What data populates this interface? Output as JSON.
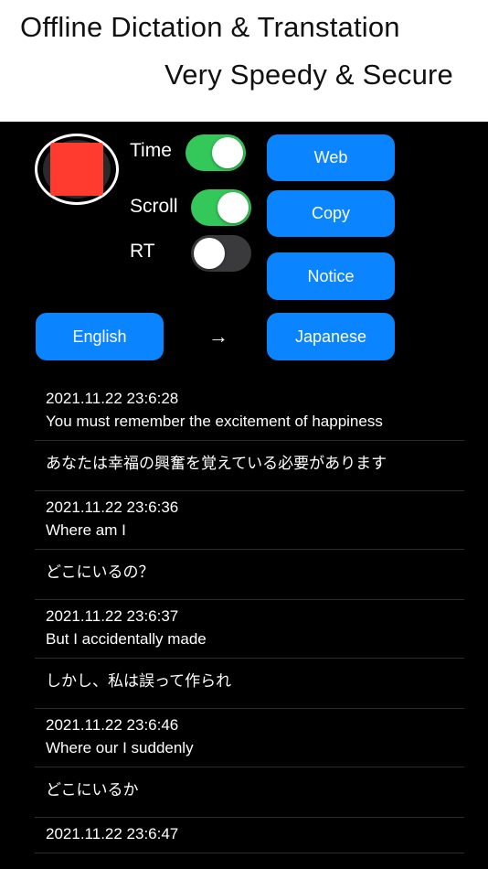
{
  "banner": {
    "line1": "Offline Dictation & Transtation",
    "line2": "Very Speedy & Secure"
  },
  "controls": {
    "record_icon": "stop-square-icon",
    "time_label": "Time",
    "time_on": true,
    "scroll_label": "Scroll",
    "scroll_on": true,
    "rt_label": "RT",
    "rt_on": false
  },
  "buttons": {
    "web": "Web",
    "copy": "Copy",
    "notice": "Notice",
    "source_lang": "English",
    "arrow": "→",
    "target_lang": "Japanese"
  },
  "colors": {
    "accent": "#0a84ff",
    "toggle_on": "#34c759",
    "stop": "#ff3b30"
  },
  "log": [
    {
      "time": "2021.11.22 23:6:28",
      "text": "You must remember the excitement of happiness",
      "translation": "あなたは幸福の興奮を覚えている必要があります"
    },
    {
      "time": "2021.11.22 23:6:36",
      "text": "Where am I",
      "translation": "どこにいるの？"
    },
    {
      "time": "2021.11.22 23:6:37",
      "text": "But I accidentally made",
      "translation": "しかし、私は誤って作られ"
    },
    {
      "time": "2021.11.22 23:6:46",
      "text": "Where our I suddenly",
      "translation": "どこにいるか"
    },
    {
      "time": "2021.11.22 23:6:47",
      "text": "",
      "translation": ""
    }
  ]
}
